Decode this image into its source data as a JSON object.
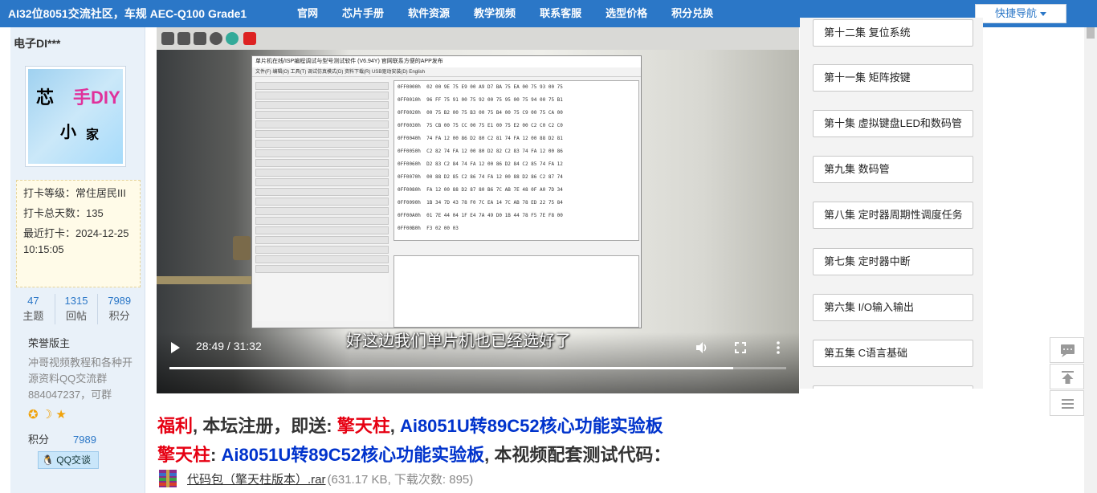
{
  "topnav": {
    "brand": "AI32位8051交流社区，车规 AEC-Q100 Grade1",
    "items": [
      "官网",
      "芯片手册",
      "软件资源",
      "教学视频",
      "联系客服",
      "选型价格",
      "积分兑换"
    ],
    "quick_nav": "快捷导航"
  },
  "user": {
    "name": "电子DI***",
    "avatar_text": [
      "芯",
      "手DIY",
      "小",
      "家"
    ],
    "checkin_level": "打卡等级：常住居民III",
    "checkin_days": "打卡总天数：135",
    "checkin_last": "最近打卡：2024-12-25 10:15:05",
    "stats": [
      {
        "num": "47",
        "label": "主题"
      },
      {
        "num": "1315",
        "label": "回帖"
      },
      {
        "num": "7989",
        "label": "积分"
      }
    ],
    "title": "荣誉版主",
    "signature": "冲哥视频教程和各种开源资料QQ交流群884047237，可群",
    "points_label": "积分",
    "points_value": "7989",
    "qq_button": "QQ交谈"
  },
  "video": {
    "subtitle": "好这边我们单片机也已经选好了",
    "time": "28:49 / 31:32",
    "progress": 0.914,
    "software_title": "单片机在线/ISP编程调试与型号测试软件 (V6.94Y) 官网联系方便的APP发布",
    "software_menu": "文件(F)  编辑(O)  工具(T)  调试仿真模式(D)  资料下载(R)  USB驱动安装(D)  English",
    "hex_lines": [
      "0FF0000h  02 00 9E 75 E9 00 A9 D7 BA 75 EA 00 75 93 00 75",
      "0FF0010h  96 FF 75 91 00 75 92 00 75 95 00 75 94 00 75 B1",
      "0FF0020h  00 75 B2 00 75 B3 00 75 B4 00 75 C9 00 75 CA 00",
      "0FF0030h  75 CB 00 75 CC 00 75 E1 00 75 E2 00 C2 C0 C2 C0",
      "0FF0040h  74 FA 12 00 86 D2 80 C2 81 74 FA 12 00 88 D2 81",
      "0FF0050h  C2 82 74 FA 12 00 80 D2 82 C2 83 74 FA 12 00 86",
      "0FF0060h  D2 83 C2 84 74 FA 12 00 86 D2 84 C2 85 74 FA 12",
      "0FF0070h  00 88 D2 85 C2 86 74 FA 12 00 88 D2 86 C2 87 74",
      "0FF0080h  FA 12 00 88 D2 87 80 B6 7C AB 7E 48 0F A0 7D 34",
      "0FF0090h  1B 34 7D 43 78 F0 7C EA 14 7C AB 78 ED 22 75 84",
      "0FF00A0h  01 7E 44 04 1F E4 7A 49 D0 1B 44 78 F5 7E F8 00",
      "0FF00B0h  F3 02 00 03"
    ]
  },
  "episodes": [
    "第十二集 复位系统",
    "第十一集 矩阵按键",
    "第十集 虚拟键盘LED和数码管",
    "第九集 数码管",
    "第八集 定时器周期性调度任务",
    "第七集 定时器中断",
    "第六集 I/O输入输出",
    "第五集 C语言基础"
  ],
  "post": {
    "line1": {
      "a": "福利",
      "b": ", 本坛注册，即送: ",
      "c": "擎天柱",
      "d": ", ",
      "e": "Ai8051U转89C52核心功能实验板"
    },
    "line2": {
      "a": "擎天柱",
      "b": ":  ",
      "c": "Ai8051U转89C52核心功能实验板",
      "d": ", 本视频配套测试代码："
    },
    "attachment_name": "代码包（擎天柱版本）.rar",
    "attachment_meta": "(631.17 KB, 下载次数: 895)"
  },
  "colors": {
    "nav_bg": "#2b77c7",
    "accent_red": "#e60012",
    "accent_blue": "#0033cc",
    "panel_bg": "#e9f1f9"
  },
  "icons": {
    "quick_nav": "chevron-down-icon",
    "play": "play-icon",
    "volume": "volume-icon",
    "fullscreen": "fullscreen-icon",
    "more": "more-vertical-icon",
    "comment": "comment-icon",
    "top": "back-to-top-icon",
    "list": "list-icon",
    "rar": "rar-file-icon",
    "qq": "qq-icon"
  }
}
